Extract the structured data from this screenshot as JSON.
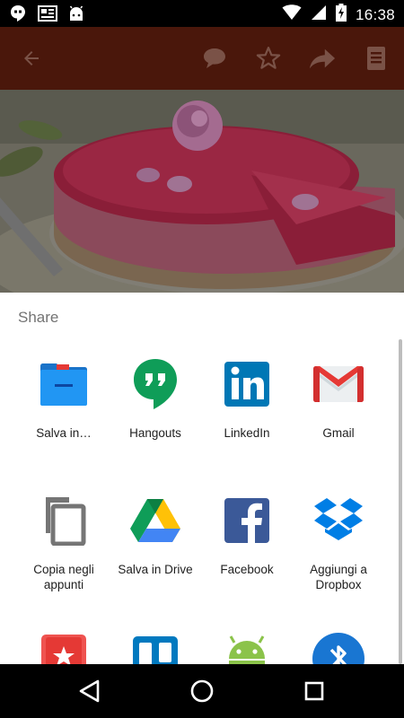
{
  "status_bar": {
    "time": "16:38",
    "left_icons": [
      "hangouts-notification-icon",
      "news-notification-icon",
      "android-notification-icon"
    ],
    "right_icons": [
      "wifi-icon",
      "signal-icon",
      "battery-charging-icon"
    ]
  },
  "app_bar": {
    "icons": [
      "back-arrow-icon",
      "comment-icon",
      "star-icon",
      "forward-icon",
      "document-icon"
    ]
  },
  "share_sheet": {
    "title": "Share",
    "apps": [
      {
        "name": "salva-in",
        "label": "Salva in…",
        "icon": "folder-icon"
      },
      {
        "name": "hangouts",
        "label": "Hangouts",
        "icon": "hangouts-icon"
      },
      {
        "name": "linkedin",
        "label": "LinkedIn",
        "icon": "linkedin-icon"
      },
      {
        "name": "gmail",
        "label": "Gmail",
        "icon": "gmail-icon"
      },
      {
        "name": "copia-negli-appunti",
        "label": "Copia negli appunti",
        "icon": "clipboard-icon"
      },
      {
        "name": "salva-in-drive",
        "label": "Salva in Drive",
        "icon": "google-drive-icon"
      },
      {
        "name": "facebook",
        "label": "Facebook",
        "icon": "facebook-icon"
      },
      {
        "name": "aggiungi-a-dropbox",
        "label": "Aggiungi a Dropbox",
        "icon": "dropbox-icon"
      },
      {
        "name": "pocket-app",
        "label": "",
        "icon": "pocket-star-icon"
      },
      {
        "name": "trello-app",
        "label": "",
        "icon": "trello-icon"
      },
      {
        "name": "android-app",
        "label": "",
        "icon": "android-icon"
      },
      {
        "name": "bluetooth-app",
        "label": "",
        "icon": "bluetooth-icon"
      }
    ]
  },
  "nav_bar": {
    "icons": [
      "back-nav-icon",
      "home-nav-icon",
      "recents-nav-icon"
    ]
  },
  "colors": {
    "app_bar_dimmed": "#4a170b",
    "sheet_background": "#ffffff",
    "title_text": "#737373",
    "label_text": "#212121"
  }
}
